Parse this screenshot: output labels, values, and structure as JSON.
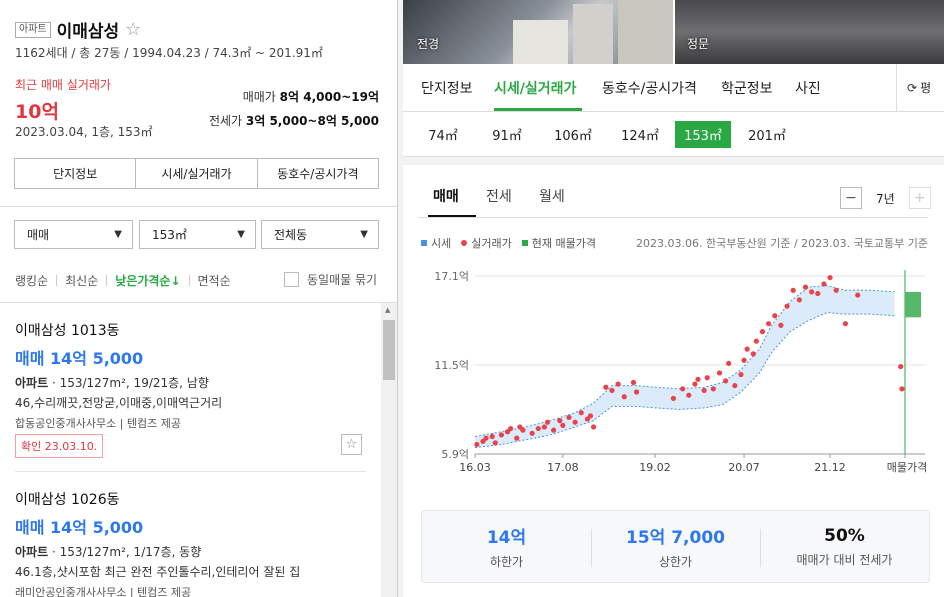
{
  "complex": {
    "type_badge": "아파트",
    "name": "이매삼성",
    "summary": "1162세대 / 총 27동 / 1994.04.23 / 74.3㎡ ~ 201.91㎡",
    "recent_label": "최근 매매 실거래가",
    "recent_price": "10억",
    "recent_date": "2023.03.04, 1층, 153㎡",
    "sale_label": "매매가",
    "sale_range": "8억 4,000~19억",
    "lease_label": "전세가",
    "lease_range": "3억 5,000~8억 5,000"
  },
  "left_buttons": [
    "단지정보",
    "시세/실거래가",
    "동호수/공시가격"
  ],
  "filters": {
    "trade": "매매",
    "area": "153㎡",
    "dong": "전체동"
  },
  "sort": {
    "options": [
      "랭킹순",
      "최신순",
      "낮은가격순↓",
      "면적순"
    ],
    "same_listing": "동일매물 묶기"
  },
  "listings": [
    {
      "title": "이매삼성 1013동",
      "price": "매매 14억 5,000",
      "kind": "아파트",
      "spec": "153/127m², 19/21층, 남향",
      "desc": "46,수리깨끗,전망굳,이매중,이매역근거리",
      "agent": "합동공인중개사사무소",
      "provider": "텐컴즈 제공",
      "confirm": "확인 23.03.10."
    },
    {
      "title": "이매삼성 1026동",
      "price": "매매 14억 5,000",
      "kind": "아파트",
      "spec": "153/127m², 1/17층, 동향",
      "desc": "46.1층,샷시포함 최근 완전 주인톨수리,인테리어 잘된 집",
      "agent": "래미안공인중개사사무소",
      "provider": "텐컴즈 제공"
    }
  ],
  "photos": [
    "전경",
    "정문"
  ],
  "tabs": [
    "단지정보",
    "시세/실거래가",
    "동호수/공시가격",
    "학군정보",
    "사진"
  ],
  "refresh_label": "평",
  "areas": [
    "74㎡",
    "91㎡",
    "106㎡",
    "124㎡",
    "153㎡",
    "201㎡"
  ],
  "subtabs": [
    "매매",
    "전세",
    "월세"
  ],
  "period": "7년",
  "legend": [
    "시세",
    "실거래가",
    "현재 매물가격"
  ],
  "source": "2023.03.06. 한국부동산원 기준 / 2023.03. 국토교통부 기준",
  "colors": {
    "accent": "#2aa843",
    "price": "#e0383e",
    "link": "#2e78ee",
    "band": "#4a90e2"
  },
  "chart_data": {
    "type": "scatter",
    "x_ticks": [
      "16.03",
      "17.08",
      "19.02",
      "20.07",
      "21.12",
      "매물가격"
    ],
    "y_ticks": [
      "17.1억",
      "11.5억",
      "5.9억"
    ],
    "ylim": [
      5.9,
      17.1
    ],
    "xlim": [
      2016.17,
      2023.17
    ],
    "series": [
      {
        "name": "시세",
        "type": "band",
        "x": [
          2016.17,
          2016.6,
          2017.0,
          2017.4,
          2017.8,
          2018.1,
          2018.4,
          2018.8,
          2019.1,
          2019.5,
          2019.9,
          2020.2,
          2020.5,
          2020.8,
          2021.0,
          2021.3,
          2021.6,
          2021.9,
          2022.2,
          2022.6,
          2023.0
        ],
        "low": [
          6.3,
          6.5,
          6.8,
          7.1,
          7.6,
          8.0,
          8.9,
          8.9,
          8.8,
          8.7,
          8.8,
          9.0,
          9.8,
          11.0,
          12.3,
          13.6,
          14.3,
          14.8,
          14.7,
          14.7,
          14.6
        ],
        "high": [
          7.0,
          7.3,
          7.6,
          8.0,
          8.5,
          9.1,
          10.2,
          10.2,
          10.1,
          10.0,
          10.1,
          10.4,
          11.2,
          12.5,
          14.0,
          15.5,
          16.4,
          16.5,
          16.2,
          16.2,
          16.1
        ]
      },
      {
        "name": "실거래가",
        "type": "scatter",
        "x": [
          2016.2,
          2016.3,
          2016.35,
          2016.45,
          2016.5,
          2016.6,
          2016.7,
          2016.75,
          2016.85,
          2016.9,
          2016.95,
          2017.1,
          2017.2,
          2017.3,
          2017.35,
          2017.45,
          2017.55,
          2017.6,
          2017.7,
          2017.8,
          2017.9,
          2018.0,
          2018.05,
          2018.1,
          2018.3,
          2018.4,
          2018.5,
          2018.6,
          2018.75,
          2018.8,
          2019.4,
          2019.55,
          2019.65,
          2019.75,
          2019.8,
          2019.9,
          2019.95,
          2020.05,
          2020.15,
          2020.25,
          2020.3,
          2020.4,
          2020.5,
          2020.55,
          2020.6,
          2020.7,
          2020.75,
          2020.85,
          2020.95,
          2021.05,
          2021.15,
          2021.25,
          2021.35,
          2021.45,
          2021.55,
          2021.65,
          2021.75,
          2021.85,
          2021.95,
          2022.05,
          2022.2,
          2022.4,
          2023.1,
          2023.12
        ],
        "y": [
          6.5,
          6.7,
          6.9,
          7.0,
          6.6,
          7.1,
          7.3,
          7.5,
          6.9,
          7.6,
          7.4,
          7.2,
          7.5,
          7.6,
          7.9,
          7.4,
          8.0,
          7.7,
          8.2,
          7.9,
          8.5,
          8.1,
          8.3,
          7.6,
          10.1,
          9.9,
          10.3,
          9.5,
          10.4,
          9.8,
          9.4,
          10.0,
          9.6,
          10.3,
          10.6,
          9.9,
          10.7,
          10.0,
          11.0,
          10.5,
          11.6,
          10.2,
          10.9,
          11.8,
          12.5,
          12.2,
          13.0,
          13.6,
          14.1,
          14.6,
          14.0,
          15.2,
          16.2,
          15.6,
          16.4,
          16.1,
          16.0,
          16.6,
          17.0,
          16.2,
          14.1,
          15.9,
          11.4,
          10.0
        ]
      },
      {
        "name": "현재 매물가격",
        "type": "range",
        "x": [
          2023.17
        ],
        "low": [
          14.5
        ],
        "high": [
          16.1
        ]
      }
    ]
  },
  "summary_stats": [
    {
      "value": "14억",
      "label": "하한가"
    },
    {
      "value": "15억 7,000",
      "label": "상한가"
    },
    {
      "value": "50%",
      "label": "매매가 대비 전세가"
    }
  ]
}
